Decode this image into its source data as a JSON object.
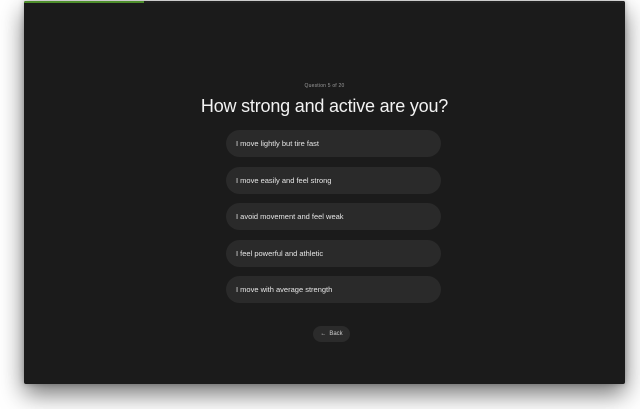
{
  "progress": {
    "current": 5,
    "total": 20,
    "fraction": 0.2,
    "color": "#4f8f2d"
  },
  "quiz": {
    "counter": "Question 5 of 20",
    "question": "How strong and active are you?",
    "options": [
      {
        "label": "I move lightly but tire fast"
      },
      {
        "label": "I move easily and feel strong"
      },
      {
        "label": "I avoid movement and feel weak"
      },
      {
        "label": "I feel powerful and athletic"
      },
      {
        "label": "I move with average strength"
      }
    ]
  },
  "navigation": {
    "back_label": "Back",
    "back_icon": "arrow-left-icon"
  },
  "colors": {
    "background": "#1b1b1b",
    "option_background": "#2a2a2a",
    "text": "#f2f2f2"
  }
}
